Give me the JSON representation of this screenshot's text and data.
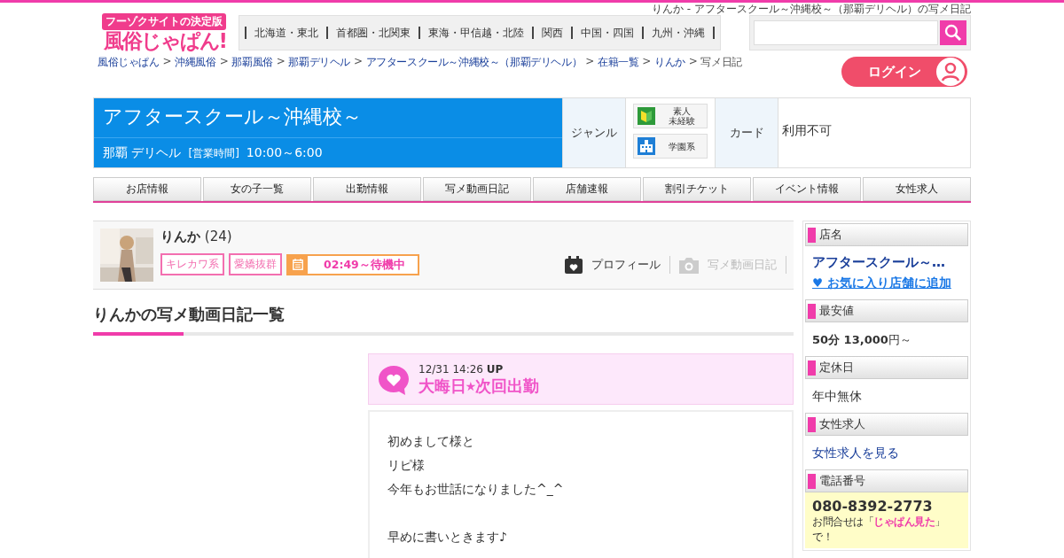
{
  "page_title": "りんか - アフタースクール～沖縄校～（那覇デリヘル）の写メ日記",
  "logo": {
    "tagline": "フーゾクサイトの決定版",
    "name": "風俗じゃぱん!"
  },
  "regions": [
    "北海道・東北",
    "首都圏・北関東",
    "東海・甲信越・北陸",
    "関西",
    "中国・四国",
    "九州・沖縄"
  ],
  "breadcrumb_separator": ">",
  "breadcrumbs": [
    {
      "label": "風俗じゃぱん",
      "link": true
    },
    {
      "label": "沖縄風俗",
      "link": true
    },
    {
      "label": "那覇風俗",
      "link": true
    },
    {
      "label": "那覇デリヘル",
      "link": true
    },
    {
      "label": "アフタースクール～沖縄校～（那覇デリヘル）",
      "link": true
    },
    {
      "label": "在籍一覧",
      "link": true
    },
    {
      "label": "りんか",
      "link": true
    },
    {
      "label": "写メ日記",
      "link": false
    }
  ],
  "login": {
    "label": "ログイン"
  },
  "shop": {
    "name": "アフタースクール～沖縄校～",
    "area": "那覇 デリヘル",
    "hours_label": "[営業時間]",
    "hours": "10:00～6:00",
    "genre_label": "ジャンル",
    "genres": [
      {
        "kind": "beginner",
        "lines": [
          "素人",
          "未経験"
        ]
      },
      {
        "kind": "school",
        "lines": [
          "学園系"
        ]
      }
    ],
    "card_label": "カード",
    "card_value": "利用不可"
  },
  "tabs": [
    {
      "label": "お店情報"
    },
    {
      "label": "女の子一覧"
    },
    {
      "label": "出勤情報"
    },
    {
      "label": "写メ動画日記"
    },
    {
      "label": "店舗速報"
    },
    {
      "label": "割引チケット"
    },
    {
      "label": "イベント情報"
    },
    {
      "label": "女性求人"
    }
  ],
  "girl": {
    "name": "りんか",
    "age": "(24)",
    "photo": {
      "kind": "picture"
    },
    "tags": [
      "キレカワ系",
      "愛嬌抜群"
    ],
    "status": "02:49～待機中",
    "links": [
      {
        "kind": "profile",
        "label": "プロフィール",
        "disabled": false
      },
      {
        "kind": "diary",
        "label": "写メ動画日記",
        "disabled": true
      }
    ]
  },
  "section_title": "りんかの写メ動画日記一覧",
  "diary": {
    "date": "12/31",
    "time": "14:26",
    "up": "UP",
    "title": "大晦日⭑次回出勤",
    "paragraphs": [
      [
        "初めまして様と",
        "リピ様",
        "今年もお世話になりました^_^"
      ],
      [
        "早めに書いときます♪"
      ]
    ]
  },
  "sidebar": [
    {
      "kind": "shop",
      "heading": "店名",
      "name": "アフタースクール～…",
      "link": "♥ お気に入り店舗に追加"
    },
    {
      "kind": "price",
      "heading": "最安値",
      "text": "**50分 13,000**円～"
    },
    {
      "kind": "text",
      "heading": "定休日",
      "text": "年中無休"
    },
    {
      "kind": "link",
      "heading": "女性求人",
      "text": "女性求人を見る"
    },
    {
      "kind": "phone",
      "heading": "電話番号",
      "number": "080-8392-2773",
      "note": "お問合せは「**じゃぱん見た**」で！"
    }
  ]
}
